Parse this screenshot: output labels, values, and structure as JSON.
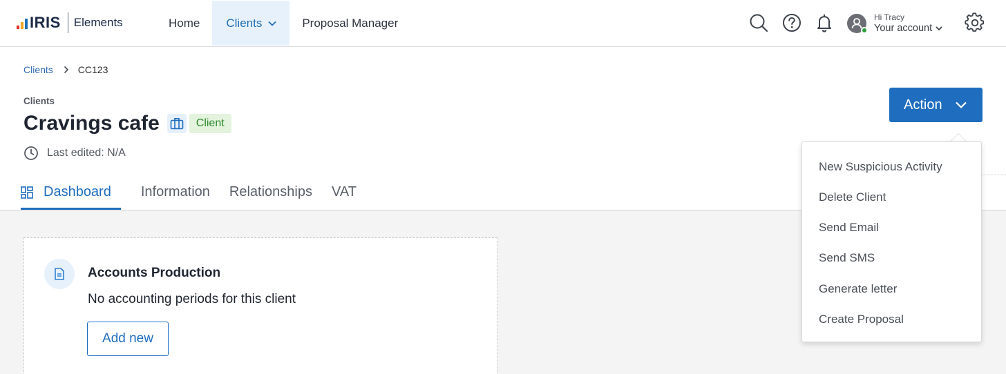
{
  "brand": {
    "logo_text": "IRIS",
    "product": "Elements"
  },
  "nav": {
    "home": "Home",
    "clients": "Clients",
    "proposal_manager": "Proposal Manager"
  },
  "account": {
    "greeting": "Hi Tracy",
    "label": "Your account"
  },
  "breadcrumb": {
    "parent": "Clients",
    "current": "CC123"
  },
  "header": {
    "section": "Clients",
    "title": "Cravings cafe",
    "badge": "Client",
    "last_edited": "Last edited: N/A"
  },
  "action_button": "Action",
  "tabs": [
    "Dashboard",
    "Information",
    "Relationships",
    "VAT"
  ],
  "card": {
    "title": "Accounts Production",
    "text": "No accounting periods for this client",
    "button": "Add new"
  },
  "action_menu": [
    "New Suspicious Activity",
    "Delete Client",
    "Send Email",
    "Send SMS",
    "Generate letter",
    "Create Proposal"
  ],
  "colors": {
    "primary": "#1f6dbf",
    "nav_active_bg": "#e7f1fb",
    "badge_bg": "#e3f3dd",
    "badge_text": "#2d8a2c",
    "content_bg": "#f4f4f4"
  }
}
